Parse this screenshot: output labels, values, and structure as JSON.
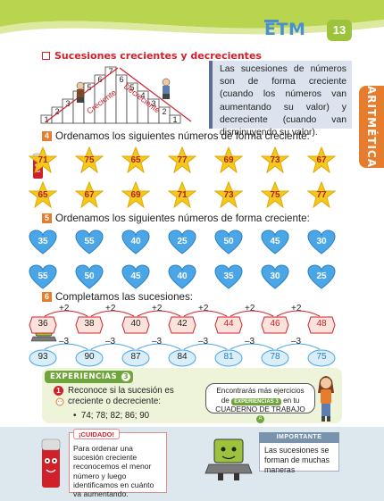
{
  "header": {
    "brand": "ETM",
    "page_number": "13",
    "side_tab": "ARITMÉTICA",
    "colors": {
      "top_wave": "#b9d54f",
      "accent": "#e57c2e",
      "brand": "#4a8fd0"
    }
  },
  "section": {
    "title": "Sucesiones crecientes y decrecientes",
    "stairs_up": [
      "1",
      "2",
      "3",
      "4",
      "5",
      "6",
      "7"
    ],
    "stairs_down": [
      "6",
      "5",
      "4",
      "3",
      "2",
      "1"
    ],
    "stair_up_label": "Creciente",
    "stair_down_label": "Decreciente",
    "info_text": "Las sucesiones de números son de forma creciente (cuando los números van aumentando su valor) y decreciente (cuando van disminuyendo su valor)."
  },
  "ex4": {
    "number": "4",
    "instruction": "Ordenamos los siguientes números de forma creciente:",
    "stars_row1": [
      "71",
      "75",
      "65",
      "77",
      "69",
      "73",
      "67"
    ],
    "stars_row2": [
      "65",
      "67",
      "69",
      "71",
      "73",
      "75",
      "77"
    ],
    "icons": [
      "star-icon",
      "marker-character-icon"
    ]
  },
  "ex5": {
    "number": "5",
    "instruction": "Ordenamos los siguientes números de forma creciente:",
    "hearts_row1": [
      "35",
      "55",
      "40",
      "25",
      "50",
      "45",
      "30"
    ],
    "hearts_row2": [
      "55",
      "50",
      "45",
      "40",
      "35",
      "30",
      "25"
    ],
    "icons": [
      "heart-icon"
    ]
  },
  "ex6": {
    "number": "6",
    "instruction": "Completamos las sucesiones:",
    "increasing": {
      "step": "+2",
      "values": [
        "36",
        "38",
        "40",
        "42",
        "44",
        "46",
        "48"
      ]
    },
    "decreasing": {
      "step": "–3",
      "values": [
        "93",
        "90",
        "87",
        "84",
        "81",
        "78",
        "75"
      ]
    }
  },
  "experiencias": {
    "label": "EXPERIENCIAS",
    "number": "3",
    "question_number": "1",
    "question": "Reconoce si la sucesión es creciente o decreciente:",
    "sequence": "74; 78; 82; 86; 90",
    "note_line1": "Encontrarás más ejercicios",
    "note_de": "de",
    "note_pill": "EXPERIENCIAS",
    "note_pill_num": "3",
    "note_en": "en tu",
    "note_line3": "CUADERNO DE TRABAJO",
    "note_badge": "A",
    "icons": [
      "girl-character-icon"
    ]
  },
  "footer": {
    "caution_title": "¡CUIDADO!",
    "caution_text": "Para ordenar una sucesión creciente reconocemos el menor número y luego identificamos en cuánto va aumentando.",
    "important_title": "IMPORTANTE",
    "important_text": "Las sucesiones se forman de muchas maneras",
    "icons": [
      "marker-character-icon",
      "laptop-character-icon"
    ]
  }
}
